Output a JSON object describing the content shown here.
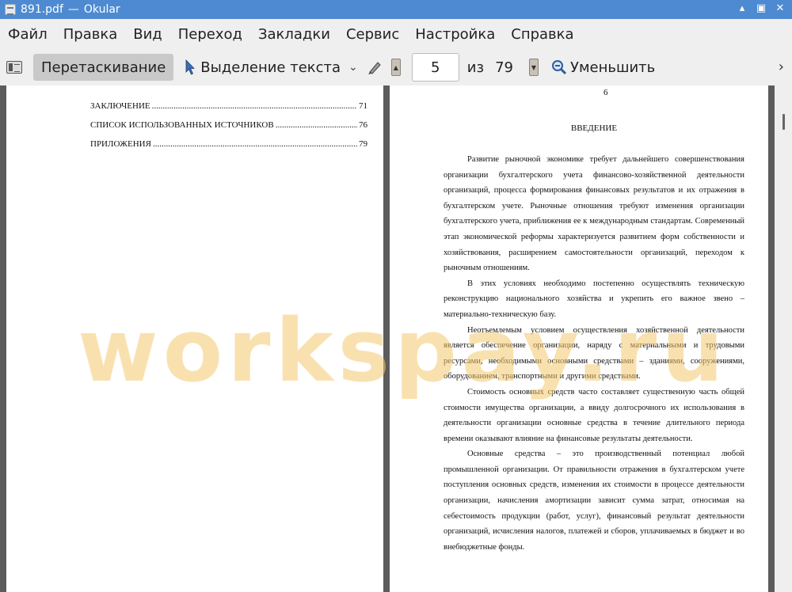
{
  "window": {
    "title": "891.pdf",
    "separator": "—",
    "app": "Okular",
    "minimize": "▴",
    "restore": "▣",
    "close": "✕"
  },
  "menu": [
    "Файл",
    "Правка",
    "Вид",
    "Переход",
    "Закладки",
    "Сервис",
    "Настройка",
    "Справка"
  ],
  "toolbar": {
    "drag_label": "Перетаскивание",
    "select_label": "Выделение текста",
    "page_current": "5",
    "of_label": "из",
    "page_total": "79",
    "zoom_out_label": "Уменьшить",
    "more": "›"
  },
  "left_page": {
    "toc": [
      {
        "title": "ЗАКЛЮЧЕНИЕ",
        "page": "71"
      },
      {
        "title": "СПИСОК ИСПОЛЬЗОВАННЫХ ИСТОЧНИКОВ",
        "page": "76"
      },
      {
        "title": "ПРИЛОЖЕНИЯ",
        "page": "79"
      }
    ]
  },
  "right_page": {
    "number": "6",
    "heading": "ВВЕДЕНИЕ",
    "paragraphs": [
      "Развитие рыночной экономике требует дальнейшего совершенствования организации бухгалтерского учета финансово-хозяйственной деятельности организаций, процесса формирования финансовых результатов и их отражения в бухгалтерском учете. Рыночные отношения требуют изменения организации бухгалтерского учета, приближения ее к международным стандартам. Современный этап экономической реформы характеризуется развитием форм собственности и хозяйствования, расширением самостоятельности организаций, переходом к рыночным отношениям.",
      "В этих условиях необходимо постепенно осуществлять техническую реконструкцию национального хозяйства и укрепить его важное звено – материально-техническую базу.",
      "Неотъемлемым условием осуществления хозяйственной деятельности является обеспечение организации, наряду с материальными и трудовыми ресурсами, необходимыми основными средствами – зданиями, сооружениями, оборудованием, транспортными и другими средствами.",
      "Стоимость основных средств часто составляет существенную часть общей стоимости имущества организации, а ввиду долгосрочного их использования в деятельности организации основные средства в течение длительного периода времени оказывают влияние на финансовые результаты деятельности.",
      "Основные средства – это производственный потенциал любой промышленной организации. От правильности отражения в бухгалтерском учете поступления основных средств, изменения их стоимости в процессе деятельности организации, начисления амортизации зависит сумма затрат, относимая на себестоимость продукции (работ, услуг), финансовый результат деятельности организаций, исчисления налогов, платежей и сборов, уплачиваемых в бюджет и во внебюджетные фонды."
    ]
  },
  "watermark": "workspay.ru",
  "colors": {
    "titlebar": "#4d8ad1",
    "doc_background": "#5c5c5c",
    "watermark": "#f4c86e"
  }
}
